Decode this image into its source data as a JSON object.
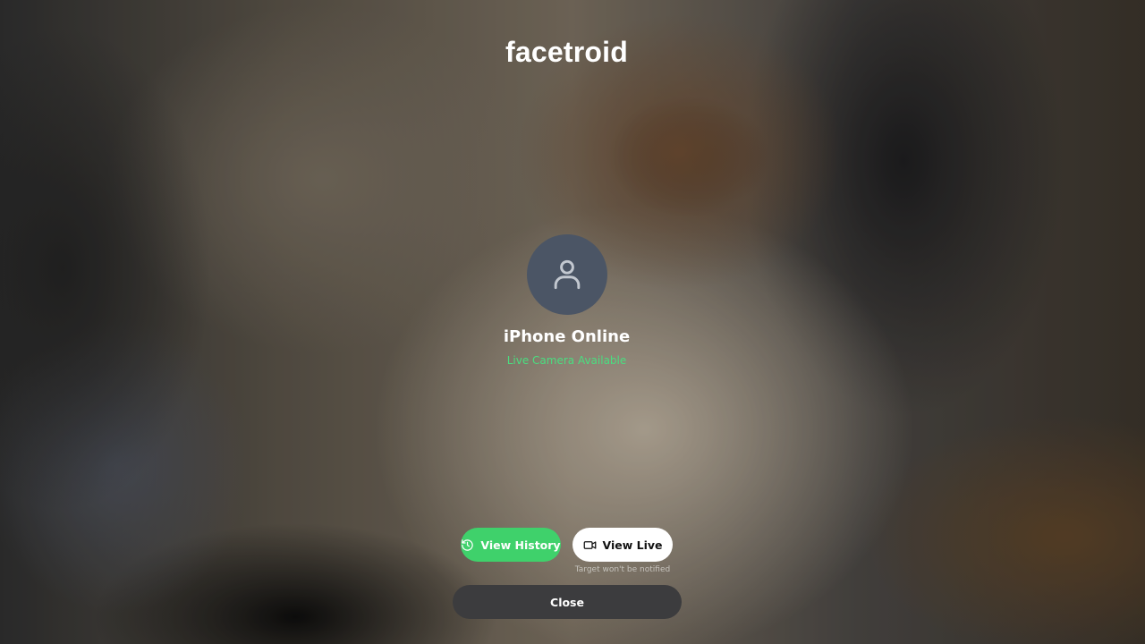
{
  "app": {
    "brand": "facetroid"
  },
  "device": {
    "name": "iPhone Online",
    "status": "Live Camera Available"
  },
  "actions": {
    "history_label": "View History",
    "live_label": "View Live",
    "live_note": "Target won't be notified",
    "close_label": "Close"
  },
  "icons": {
    "avatar": "user-icon",
    "history": "history-icon",
    "live": "video-camera-icon"
  },
  "colors": {
    "accent_green": "#3fd16b",
    "status_green": "#4ade80",
    "avatar_bg": "#4b5565",
    "close_bg": "#3c3c3e"
  }
}
